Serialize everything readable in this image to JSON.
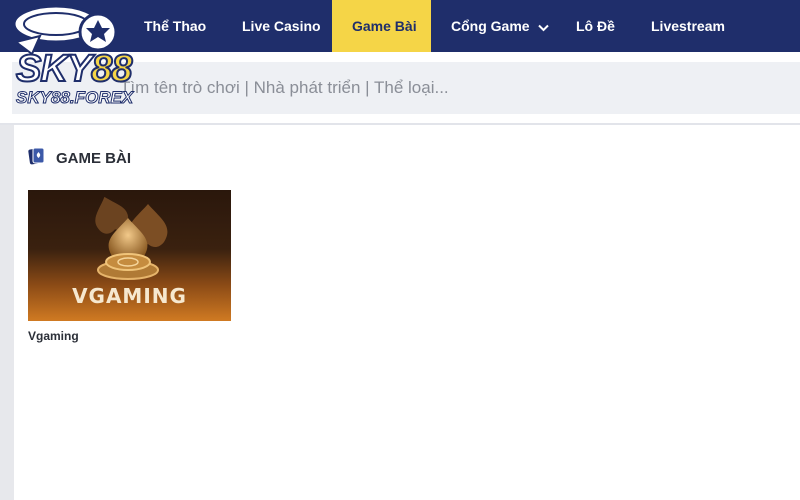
{
  "brand": {
    "logo_text_main": "SKY",
    "logo_text_number": "88",
    "logo_domain": "SKY88.FOREX"
  },
  "nav": {
    "items": [
      {
        "label": "Thể Thao"
      },
      {
        "label": "Live Casino"
      },
      {
        "label": "Game Bài",
        "active": true
      },
      {
        "label": "Cổng Game",
        "has_dropdown": true
      },
      {
        "label": "Lô Đề"
      },
      {
        "label": "Livestream"
      }
    ]
  },
  "search": {
    "placeholder": "Tìm tên trò chơi | Nhà phát triển | Thể loại..."
  },
  "section": {
    "title": "GAME BÀI",
    "icon": "cards-icon"
  },
  "games": [
    {
      "name": "Vgaming",
      "thumb_label": "VGAMING"
    }
  ],
  "colors": {
    "nav_bg": "#1f2e6b",
    "active_tab": "#f5d547",
    "search_bg": "#eef0f4"
  }
}
